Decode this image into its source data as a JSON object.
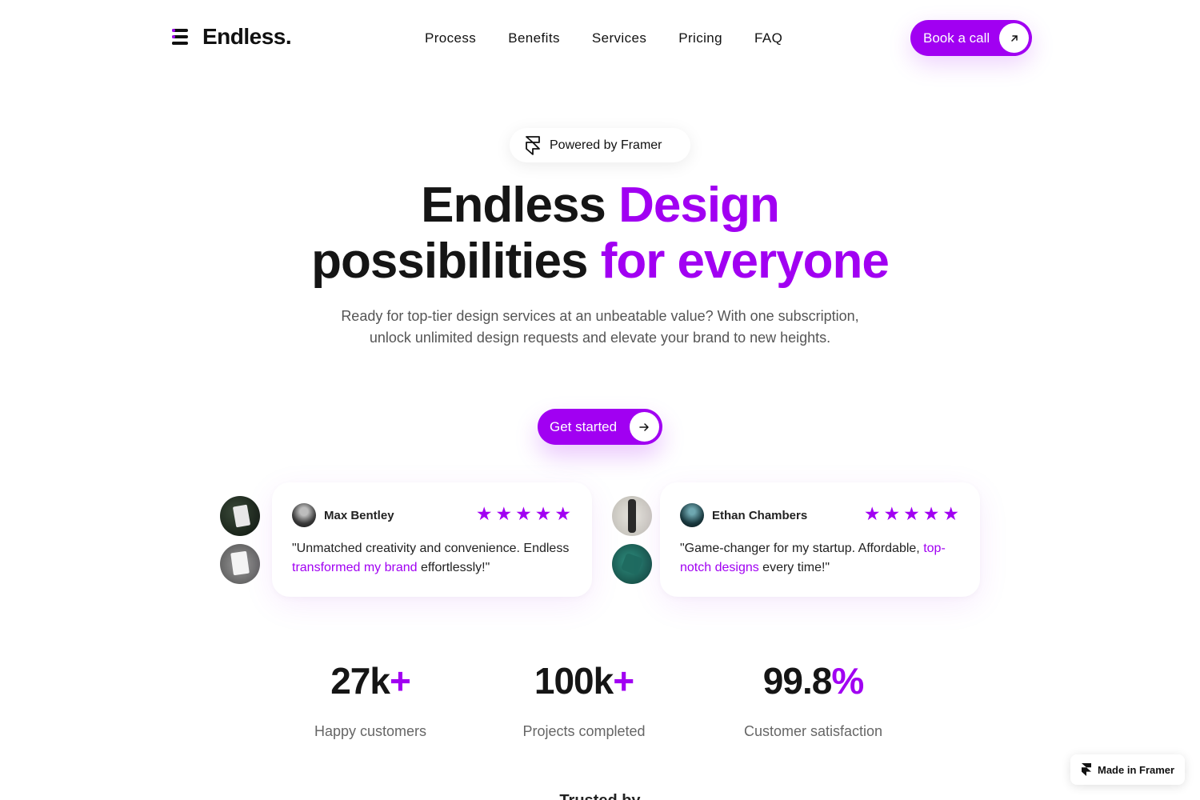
{
  "brand": {
    "name": "Endless.",
    "accent": "#a100f2"
  },
  "nav": {
    "items": [
      {
        "label": "Process"
      },
      {
        "label": "Benefits"
      },
      {
        "label": "Services"
      },
      {
        "label": "Pricing"
      },
      {
        "label": "FAQ"
      }
    ],
    "cta_label": "Book a call"
  },
  "hero": {
    "badge_label": "Powered by Framer",
    "title_line1_plain": "Endless ",
    "title_line1_accent": "Design",
    "title_line2_plain": "possibilities ",
    "title_line2_accent": "for everyone",
    "subtitle": "Ready for top-tier design services at an unbeatable value? With one subscription, unlock unlimited design requests and elevate your brand to new heights.",
    "cta_label": "Get started"
  },
  "testimonials": [
    {
      "name": "Max Bentley",
      "rating": 5,
      "quote_before": "\"Unmatched creativity and convenience. Endless ",
      "quote_highlight": "transformed my brand",
      "quote_after": " effortlessly!\""
    },
    {
      "name": "Ethan Chambers",
      "rating": 5,
      "quote_before": "\"Game-changer for my startup. Affordable, ",
      "quote_highlight": "top-notch designs",
      "quote_after": " every time!\""
    }
  ],
  "stats": [
    {
      "value": "27k",
      "suffix": "+",
      "label": "Happy customers"
    },
    {
      "value": "100k",
      "suffix": "+",
      "label": "Projects completed"
    },
    {
      "value": "99.8",
      "suffix": "%",
      "label": "Customer satisfaction"
    }
  ],
  "trusted_heading": "Trusted by",
  "made_in_framer": "Made in Framer",
  "icons": {
    "logo": "menu-bars-icon",
    "book_arrow": "arrow-up-right-icon",
    "cta_arrow": "arrow-right-icon",
    "framer": "framer-icon",
    "star": "star-icon"
  }
}
